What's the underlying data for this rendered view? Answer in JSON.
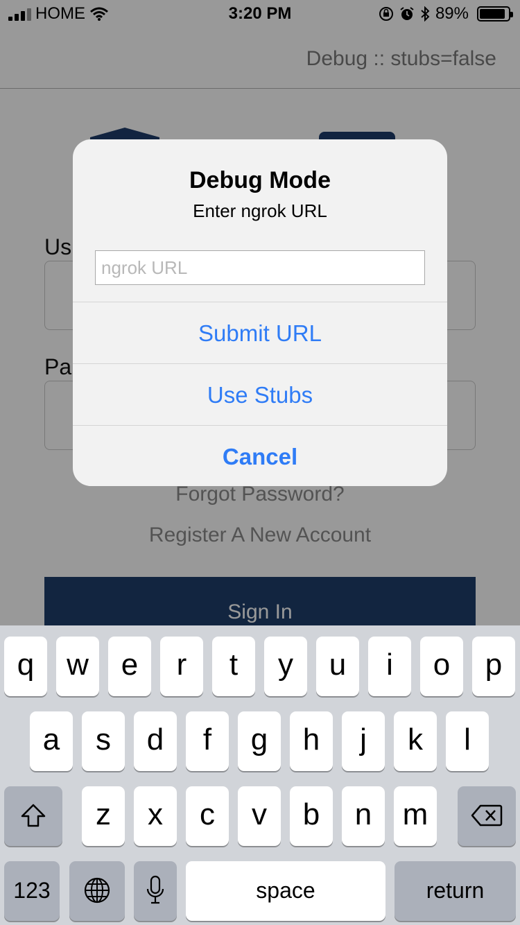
{
  "status_bar": {
    "carrier": "HOME",
    "time": "3:20 PM",
    "battery_percent": "89%",
    "battery_level": 0.89,
    "icons": [
      "signal-icon",
      "wifi-icon",
      "orientation-lock-icon",
      "alarm-icon",
      "bluetooth-icon",
      "battery-icon"
    ]
  },
  "nav": {
    "debug_label": "Debug :: stubs=false"
  },
  "form": {
    "username_label": "Us",
    "password_label": "Pa",
    "forgot_password": "Forgot Password?",
    "register": "Register A New Account",
    "sign_in": "Sign In"
  },
  "alert": {
    "title": "Debug Mode",
    "message": "Enter ngrok URL",
    "input_value": "",
    "input_placeholder": "ngrok URL",
    "actions": {
      "submit": "Submit URL",
      "stubs": "Use Stubs",
      "cancel": "Cancel"
    },
    "accent_color": "#2f7cf6"
  },
  "keyboard": {
    "row1": [
      "q",
      "w",
      "e",
      "r",
      "t",
      "y",
      "u",
      "i",
      "o",
      "p"
    ],
    "row2": [
      "a",
      "s",
      "d",
      "f",
      "g",
      "h",
      "j",
      "k",
      "l"
    ],
    "row3": [
      "z",
      "x",
      "c",
      "v",
      "b",
      "n",
      "m"
    ],
    "numbers_key": "123",
    "space_key": "space",
    "return_key": "return",
    "icons": [
      "shift-icon",
      "delete-icon",
      "globe-icon",
      "microphone-icon"
    ]
  },
  "colors": {
    "brand_navy": "#1f3f6c",
    "keyboard_bg": "#d1d4d9",
    "gray_key": "#abb0ba"
  }
}
